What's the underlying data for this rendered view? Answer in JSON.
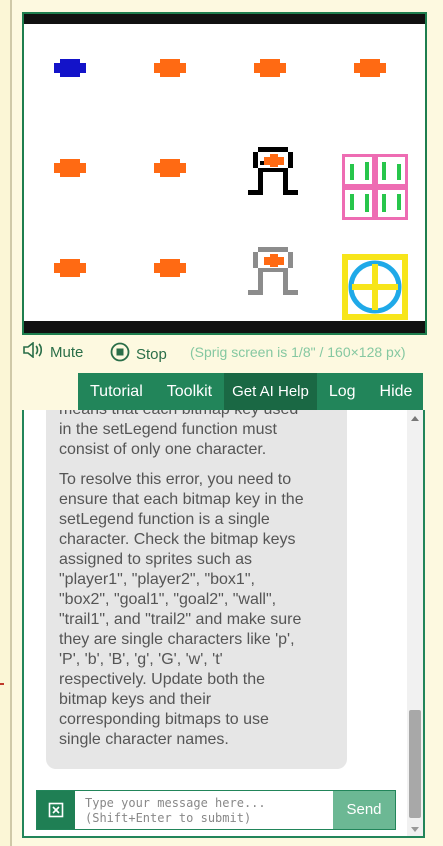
{
  "controls": {
    "mute_label": "Mute",
    "stop_label": "Stop",
    "screen_hint": "(Sprig screen is 1/8\" / 160×128 px)"
  },
  "tabs": [
    {
      "label": "Tutorial",
      "active": false
    },
    {
      "label": "Toolkit",
      "active": false
    },
    {
      "label": "Get AI Help",
      "active": true
    },
    {
      "label": "Log",
      "active": false
    },
    {
      "label": "Hide",
      "active": false
    }
  ],
  "chat": {
    "message_p1": "means that each bitmap key used\nin the setLegend function must\nconsist of only one character.",
    "message_p2": "To resolve this error, you need to\nensure that each bitmap key in the\nsetLegend function is a single\ncharacter. Check the bitmap keys\nassigned to sprites such as\n\"player1\", \"player2\", \"box1\",\n\"box2\", \"goal1\", \"goal2\", \"wall\",\n\"trail1\", and \"trail2\" and make sure\nthey are single characters like 'p',\n'P', 'b', 'B', 'g', 'G', 'w', 't'\nrespectively. Update both the\nbitmap keys and their\ncorresponding bitmaps to use\nsingle character names.",
    "input_placeholder": "Type your message here...\n(Shift+Enter to submit)",
    "send_label": "Send"
  },
  "colors": {
    "accent_green": "#22855a",
    "sprite_orange": "#ff6a13",
    "sprite_blue": "#1313c9",
    "goal_pink": "#ee6cb3",
    "goal_yellow": "#f7e51a"
  }
}
